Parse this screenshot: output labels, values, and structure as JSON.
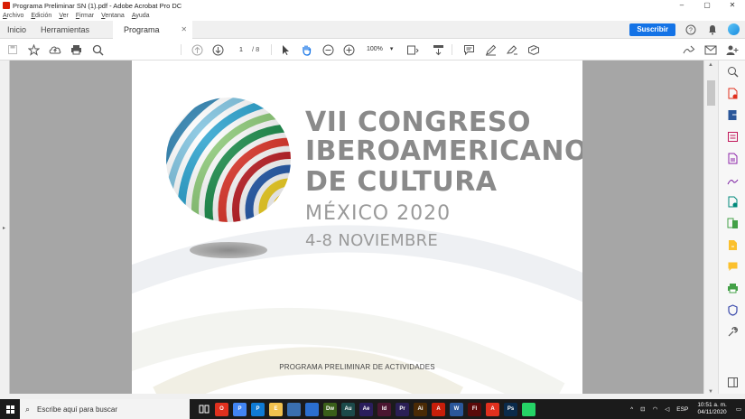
{
  "window": {
    "title": "Programa Preliminar SN (1).pdf - Adobe Acrobat Pro DC",
    "controls": [
      "–",
      "▢",
      "✕"
    ]
  },
  "menu": [
    "Archivo",
    "Edición",
    "Ver",
    "Firmar",
    "Ventana",
    "Ayuda"
  ],
  "tabs": {
    "home": "Inicio",
    "tools": "Herramientas",
    "document": "Programa Prelimin...",
    "close": "✕"
  },
  "header_actions": {
    "subscribe": "Suscribir",
    "help_icon": "help-icon",
    "bell_icon": "bell-icon"
  },
  "toolbar": {
    "page_current": "1",
    "page_total": "/ 8",
    "zoom": "100%",
    "zoom_arrow": "▾"
  },
  "document": {
    "line1": "VII CONGRESO",
    "line2": "IBEROAMERICANO",
    "line3": "DE CULTURA",
    "line4": "MÉXICO 2020",
    "line5": "4-8 NOVIEMBRE",
    "footer": "PROGRAMA PRELIMINAR DE ACTIVIDADES"
  },
  "taskbar": {
    "search_placeholder": "Escribe aquí para buscar",
    "apps": [
      {
        "name": "opera",
        "label": "O",
        "color": "#e0301e"
      },
      {
        "name": "chrome",
        "label": "P",
        "color": "#4285f4"
      },
      {
        "name": "edge",
        "label": "P",
        "color": "#0f7bd5"
      },
      {
        "name": "explorer",
        "label": "E",
        "color": "#f2c14e"
      },
      {
        "name": "store",
        "label": "",
        "color": "#3a6fb0"
      },
      {
        "name": "mail",
        "label": "",
        "color": "#2b6fcf"
      },
      {
        "name": "dreamweaver",
        "label": "Dw",
        "color": "#3a5f1a"
      },
      {
        "name": "audition",
        "label": "Au",
        "color": "#1c4a4a"
      },
      {
        "name": "after-effects",
        "label": "Ae",
        "color": "#2a1e5c"
      },
      {
        "name": "indesign",
        "label": "Id",
        "color": "#4b1630"
      },
      {
        "name": "premiere",
        "label": "Pr",
        "color": "#2a1f55"
      },
      {
        "name": "illustrator",
        "label": "Ai",
        "color": "#4a2a05"
      },
      {
        "name": "acrobat-dc",
        "label": "A",
        "color": "#c81e0a"
      },
      {
        "name": "word",
        "label": "W",
        "color": "#2b579a"
      },
      {
        "name": "flash",
        "label": "Fl",
        "color": "#5a0a0a"
      },
      {
        "name": "acrobat",
        "label": "A",
        "color": "#e0301e"
      },
      {
        "name": "photoshop",
        "label": "Ps",
        "color": "#0a2a4a"
      },
      {
        "name": "whatsapp",
        "label": "",
        "color": "#25d366"
      }
    ],
    "lang": "ESP",
    "time": "10:51 a. m.",
    "date": "04/11/2020"
  },
  "colors": {
    "accent": "#1473e6",
    "acrobat_red": "#d81e05"
  }
}
